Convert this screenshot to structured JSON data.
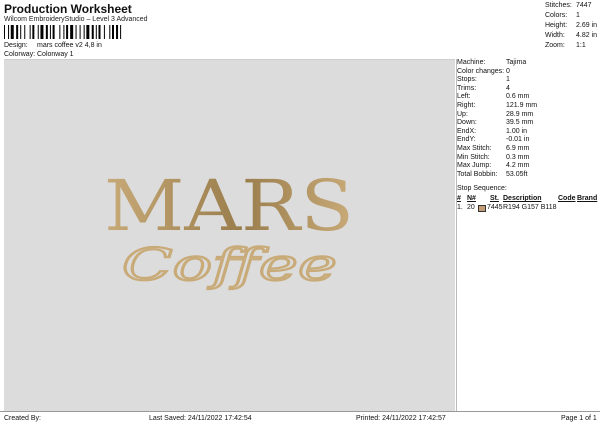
{
  "header": {
    "title": "Production Worksheet",
    "subtitle": "Wilcom EmbroideryStudio – Level 3 Advanced",
    "design_label": "Design:",
    "design_value": "mars coffee v2 4,8 in",
    "colorway_label": "Colorway:",
    "colorway_value": "Colonway 1"
  },
  "summary": [
    {
      "label": "Stitches:",
      "value": "7447"
    },
    {
      "label": "Colors:",
      "value": "1"
    },
    {
      "label": "Height:",
      "value": "2.69 in"
    },
    {
      "label": "Width:",
      "value": "4.82 in"
    },
    {
      "label": "Zoom:",
      "value": "1:1"
    }
  ],
  "machine_info": [
    {
      "label": "Machine:",
      "value": "Tajima"
    },
    {
      "label": "Color changes:",
      "value": "0"
    },
    {
      "label": "Stops:",
      "value": "1"
    },
    {
      "label": "Trims:",
      "value": "4"
    },
    {
      "label": "Left:",
      "value": "0.6 mm"
    },
    {
      "label": "Right:",
      "value": "121.9 mm"
    },
    {
      "label": "Up:",
      "value": "28.9 mm"
    },
    {
      "label": "Down:",
      "value": "39.5 mm"
    },
    {
      "label": "EndX:",
      "value": "1.00 in"
    },
    {
      "label": "EndY:",
      "value": "-0.01 in"
    },
    {
      "label": "Max Stitch:",
      "value": "6.9 mm"
    },
    {
      "label": "Min Stitch:",
      "value": "0.3 mm"
    },
    {
      "label": "Max Jump:",
      "value": "4.2 mm"
    },
    {
      "label": "Total Bobbin:",
      "value": "53.05ft"
    }
  ],
  "stop_sequence": {
    "title": "Stop Sequence:",
    "headers": {
      "num": "#",
      "n": "N#",
      "st": "St.",
      "desc": "Description",
      "code": "Code",
      "brand": "Brand"
    },
    "rows": [
      {
        "num": "1.",
        "n": "20",
        "st": "7445",
        "desc": "R194 G157 B118",
        "code": "",
        "brand": "",
        "color": "#c29d76"
      }
    ]
  },
  "design": {
    "line1": "MARS",
    "line2": "Coffee",
    "thread_color": "#c8ab78",
    "shade_color": "#9a7d4c"
  },
  "footer": {
    "created_by": "Created By:",
    "last_saved": "Last Saved: 24/11/2022 17:42:54",
    "printed": "Printed: 24/11/2022 17:42:57",
    "page": "Page 1 of 1"
  }
}
